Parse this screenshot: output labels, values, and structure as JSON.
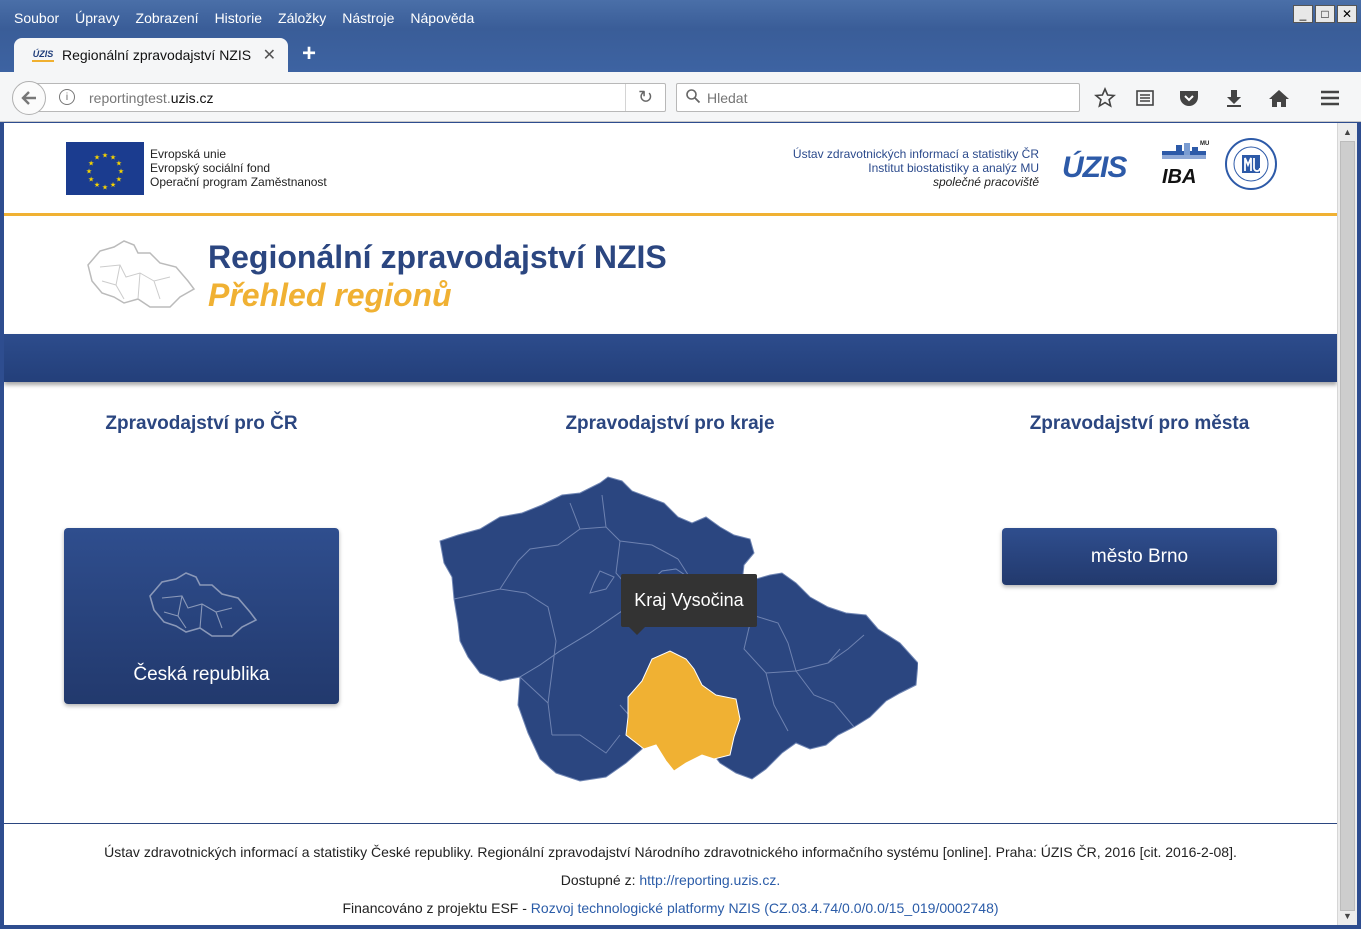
{
  "browser": {
    "menu": [
      "Soubor",
      "Úpravy",
      "Zobrazení",
      "Historie",
      "Záložky",
      "Nástroje",
      "Nápověda"
    ],
    "tab_title": "Regionální zpravodajství NZIS",
    "tab_favicon": "ÚZIS",
    "url_host": "reportingtest.",
    "url_domain": "uzis.cz",
    "search_placeholder": "Hledat"
  },
  "header": {
    "eu_lines": [
      "Evropská unie",
      "Evropský sociální fond",
      "Operační program Zaměstnanost"
    ],
    "partners": [
      "Ústav zdravotnických informací a statistiky ČR",
      "Institut biostatistiky a analýz MU",
      "společné pracoviště"
    ],
    "logo_uzis": "ÚZIS",
    "logo_iba": "IBA",
    "logo_iba_mu": "MU",
    "title": "Regionální zpravodajství NZIS",
    "subtitle": "Přehled regionů"
  },
  "columns": {
    "cr_heading": "Zpravodajství pro ČR",
    "kraje_heading": "Zpravodajství pro kraje",
    "mesta_heading": "Zpravodajství pro města",
    "cr_button": "Česká republika",
    "brno_button": "město Brno"
  },
  "map": {
    "tooltip": "Kraj Vysočina",
    "base_color": "#2b4680",
    "highlight_color": "#f0b133"
  },
  "footer": {
    "citation": "Ústav zdravotnických informací a statistiky České republiky. Regionální zpravodajství Národního zdravotnického informačního systému [online]. Praha: ÚZIS ČR, 2016 [cit. 2016-2-08].",
    "available_label": "Dostupné z:",
    "available_link": "http://reporting.uzis.cz.",
    "financed_label": "Financováno z projektu ESF -",
    "financed_link": "Rozvoj technologické platformy NZIS (CZ.03.4.74/0.0/0.0/15_019/0002748)"
  }
}
